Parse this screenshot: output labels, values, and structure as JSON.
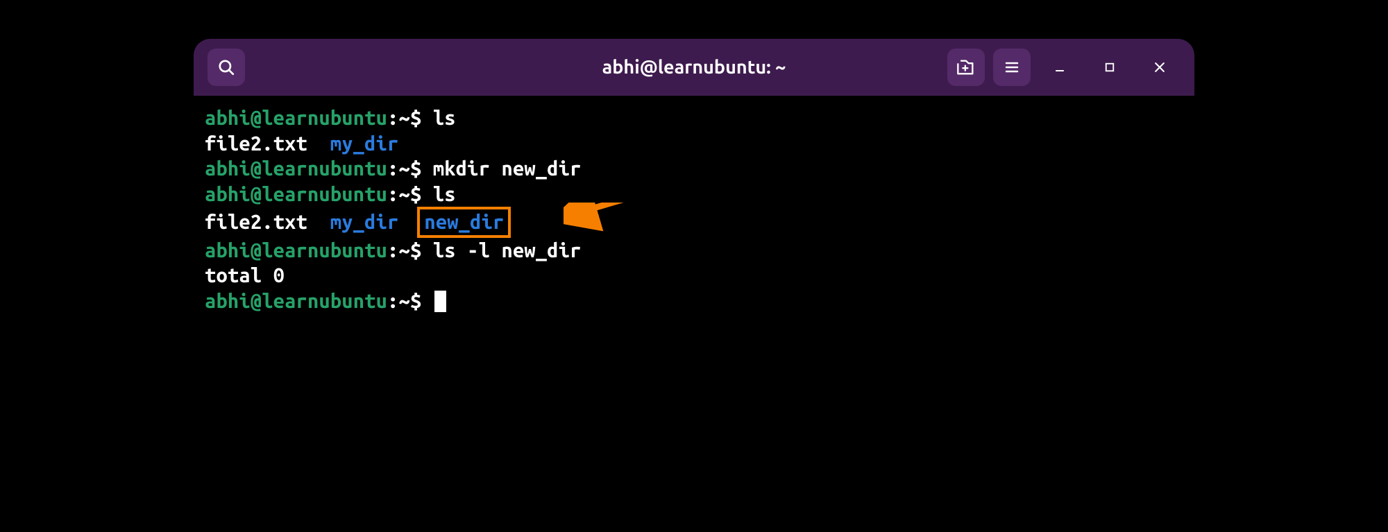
{
  "window": {
    "title": "abhi@learnubuntu: ~"
  },
  "icons": {
    "search": "search-icon",
    "new_tab": "new-tab-icon",
    "menu": "menu-icon",
    "minimize": "minimize-icon",
    "maximize": "maximize-icon",
    "close": "close-icon"
  },
  "colors": {
    "titlebar": "#3e1b4e",
    "accent": "#542a68",
    "prompt_user": "#26a269",
    "directory": "#2a7bde",
    "highlight_border": "#f77f00"
  },
  "terminal": {
    "lines": [
      {
        "prompt_user": "abhi@learnubuntu",
        "prompt_path": "~",
        "command": "ls"
      },
      {
        "output_file": "file2.txt",
        "output_dir1": "my_dir"
      },
      {
        "prompt_user": "abhi@learnubuntu",
        "prompt_path": "~",
        "command": "mkdir new_dir"
      },
      {
        "prompt_user": "abhi@learnubuntu",
        "prompt_path": "~",
        "command": "ls"
      },
      {
        "output_file": "file2.txt",
        "output_dir1": "my_dir",
        "output_dir2": "new_dir"
      },
      {
        "prompt_user": "abhi@learnubuntu",
        "prompt_path": "~",
        "command": "ls -l new_dir"
      },
      {
        "output_text": "total 0"
      },
      {
        "prompt_user": "abhi@learnubuntu",
        "prompt_path": "~",
        "command": ""
      }
    ],
    "separator_colon": ":",
    "separator_dollar": "$",
    "separator_spaces_wide": "  ",
    "separator_space": " "
  }
}
